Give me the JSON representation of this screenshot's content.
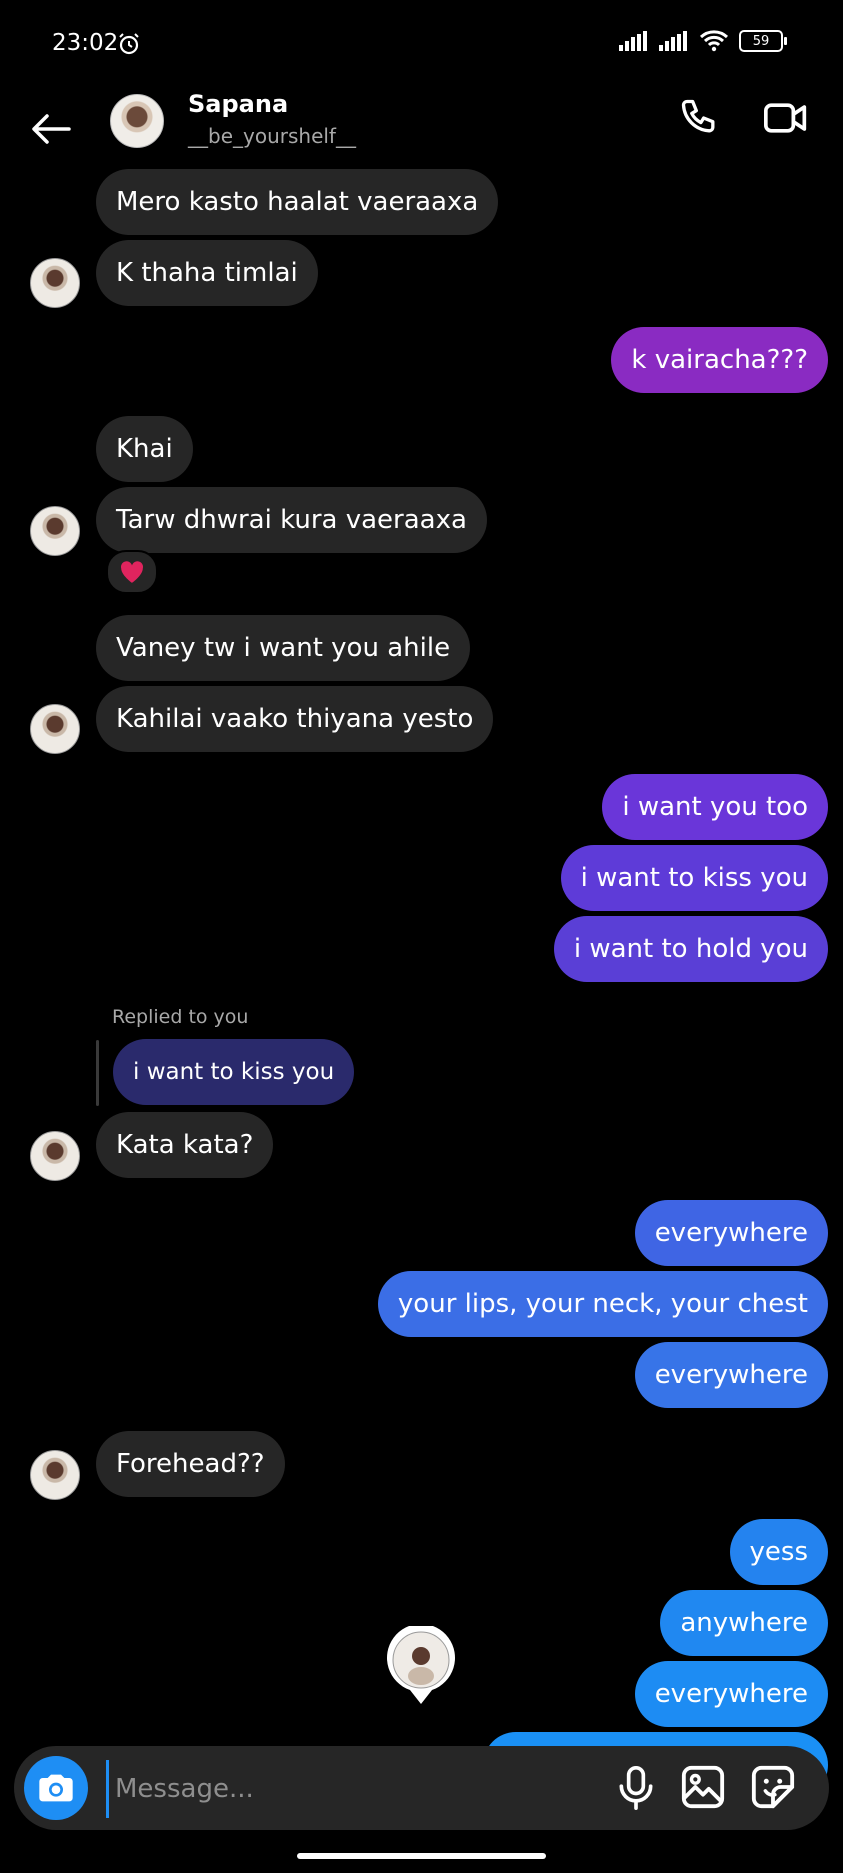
{
  "status_bar": {
    "time": "23:02",
    "battery": "59",
    "icons": [
      "alarm-icon",
      "signal-icon",
      "signal-icon",
      "wifi-icon",
      "battery-icon"
    ]
  },
  "header": {
    "name": "Sapana",
    "handle": "__be_yourshelf__",
    "icons": [
      "back-arrow-icon",
      "phone-icon",
      "video-camera-icon"
    ]
  },
  "messages": [
    {
      "from": "them",
      "text": "Mero kasto haalat vaeraaxa"
    },
    {
      "from": "them",
      "text": "K thaha timlai"
    },
    {
      "from": "me",
      "text": "k vairacha???"
    },
    {
      "from": "them",
      "text": "Khai"
    },
    {
      "from": "them",
      "text": "Tarw dhwrai kura vaeraaxa",
      "reaction": "❤️"
    },
    {
      "from": "them",
      "text": "Vaney tw i want you ahile"
    },
    {
      "from": "them",
      "text": "Kahilai vaako thiyana yesto"
    },
    {
      "from": "me",
      "text": "i want you too"
    },
    {
      "from": "me",
      "text": "i want to kiss you"
    },
    {
      "from": "me",
      "text": "i want to hold you"
    },
    {
      "from": "them",
      "text": "Kata kata?",
      "reply": {
        "label": "Replied to you",
        "quoted": "i want to kiss you"
      }
    },
    {
      "from": "me",
      "text": "everywhere"
    },
    {
      "from": "me",
      "text": "your lips, your neck, your chest"
    },
    {
      "from": "me",
      "text": "everywhere"
    },
    {
      "from": "them",
      "text": "Forehead??"
    },
    {
      "from": "me",
      "text": "yess"
    },
    {
      "from": "me",
      "text": "anywhere"
    },
    {
      "from": "me",
      "text": "everywhere"
    }
  ],
  "composer": {
    "placeholder": "Message...",
    "icons": [
      "camera-icon",
      "microphone-icon",
      "image-icon",
      "sticker-icon"
    ]
  },
  "colors": {
    "incoming": "#262626",
    "outgoing_purple": "#8a2bc2",
    "outgoing_indigo": "#5b3fd6",
    "outgoing_blue": "#3b6ee6",
    "outgoing_sky": "#1e8ef4"
  }
}
